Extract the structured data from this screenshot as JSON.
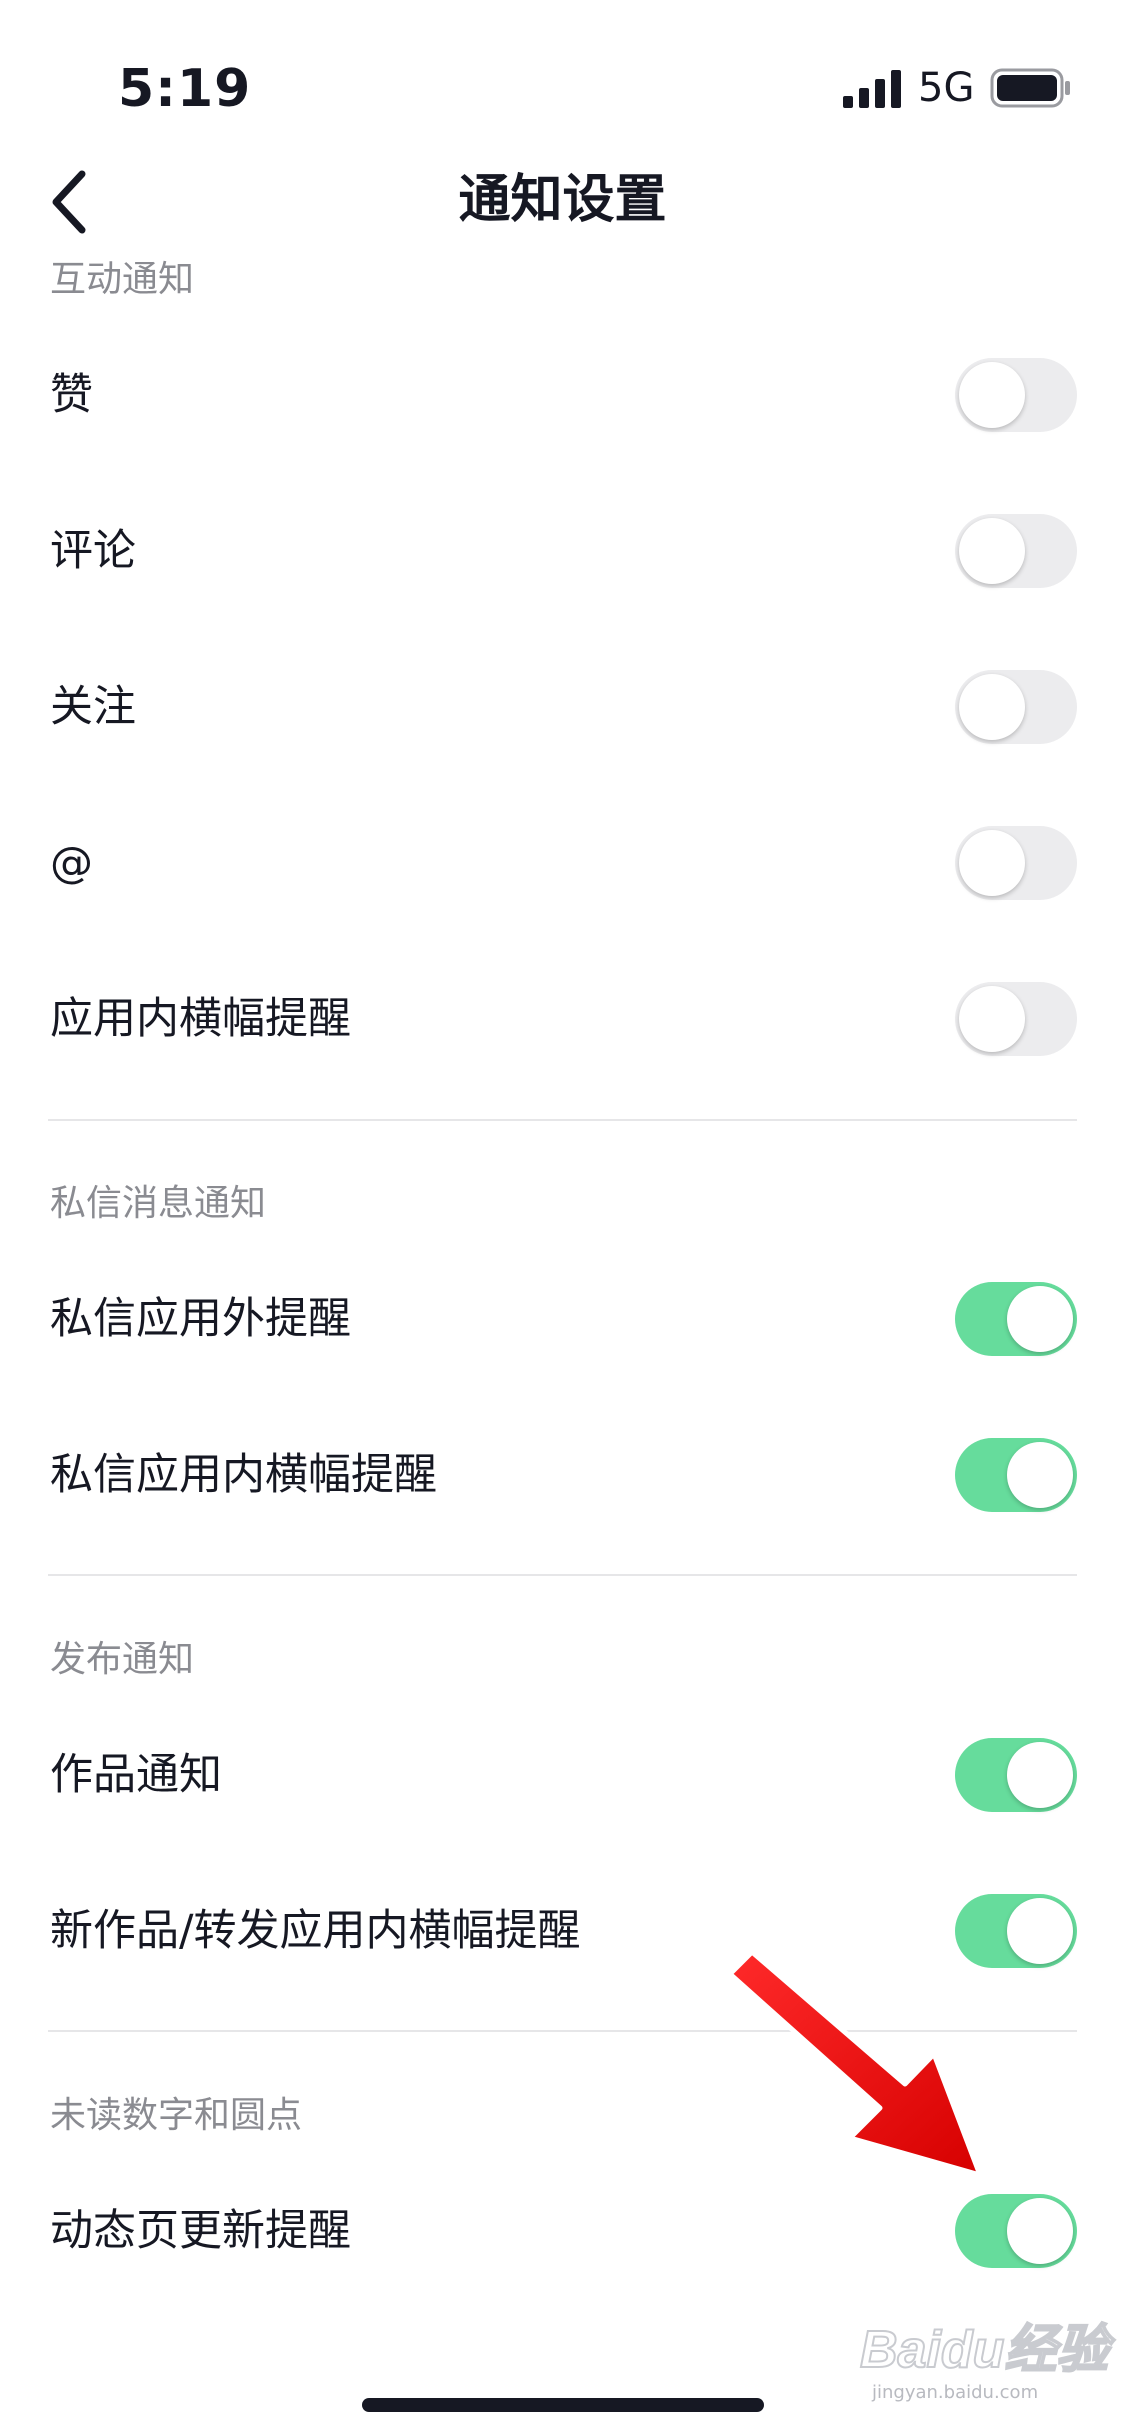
{
  "status_bar": {
    "time": "5:19",
    "network": "5G",
    "signal_icon": "cellular-signal-icon",
    "battery_icon": "battery-icon"
  },
  "nav": {
    "back_icon": "chevron-left-icon",
    "title": "通知设置"
  },
  "colors": {
    "toggle_on": "#66dc9c",
    "toggle_off": "#ececee",
    "section_header": "#8a8b91",
    "text": "#161823",
    "annotation_arrow": "#e8000b"
  },
  "sections": [
    {
      "header": "互动通知",
      "items": [
        {
          "label": "赞",
          "on": false
        },
        {
          "label": "评论",
          "on": false
        },
        {
          "label": "关注",
          "on": false
        },
        {
          "label": "@",
          "on": false
        },
        {
          "label": "应用内横幅提醒",
          "on": false
        }
      ]
    },
    {
      "header": "私信消息通知",
      "items": [
        {
          "label": "私信应用外提醒",
          "on": true
        },
        {
          "label": "私信应用内横幅提醒",
          "on": true
        }
      ]
    },
    {
      "header": "发布通知",
      "items": [
        {
          "label": "作品通知",
          "on": true
        },
        {
          "label": "新作品/转发应用内横幅提醒",
          "on": true
        }
      ]
    },
    {
      "header": "未读数字和圆点",
      "items": [
        {
          "label": "动态页更新提醒",
          "on": true
        }
      ]
    }
  ],
  "watermark": {
    "logo": "Baidu经验",
    "url": "jingyan.baidu.com"
  }
}
